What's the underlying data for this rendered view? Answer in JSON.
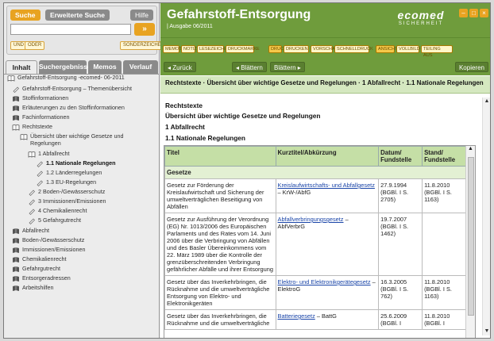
{
  "search": {
    "tab_active": "Suche",
    "tab_extended": "Erweiterte Suche",
    "help": "Hilfe",
    "go": "»",
    "btn_und": "UND",
    "btn_oder": "ODER",
    "btn_sonderzeichen": "SONDERZEICHEN"
  },
  "nav_tabs": [
    "Inhalt",
    "Suchergebnisse",
    "Memos",
    "Verlauf"
  ],
  "tree": [
    {
      "label": "Gefahrstoff-Entsorgung -ecomed- 06-2011",
      "icon": "book-open-icon"
    },
    {
      "label": "Gefahrstoff-Entsorgung – Themenübersicht",
      "icon": "page-icon"
    },
    {
      "label": "Stoffinformationen",
      "icon": "book-icon"
    },
    {
      "label": "Erläuterungen zu den Stoffinformationen",
      "icon": "book-icon"
    },
    {
      "label": "Fachinformationen",
      "icon": "book-icon"
    },
    {
      "label": "Rechtstexte",
      "icon": "book-open-icon"
    },
    {
      "label": "Übersicht über wichtige Gesetze und Regelungen",
      "icon": "book-open-icon"
    },
    {
      "label": "1 Abfallrecht",
      "icon": "book-open-icon"
    },
    {
      "label": "1.1 Nationale Regelungen",
      "icon": "page-icon",
      "bold": true
    },
    {
      "label": "1.2 Länderregelungen",
      "icon": "page-icon"
    },
    {
      "label": "1.3 EU-Regelungen",
      "icon": "page-icon"
    },
    {
      "label": "2 Boden-/Gewässerschutz",
      "icon": "page-icon"
    },
    {
      "label": "3 Immissionen/Emissionen",
      "icon": "page-icon"
    },
    {
      "label": "4 Chemikalienrecht",
      "icon": "page-icon"
    },
    {
      "label": "5 Gefahrgutrecht",
      "icon": "page-icon"
    },
    {
      "label": "Abfallrecht",
      "icon": "book-icon"
    },
    {
      "label": "Boden-/Gewässerschutz",
      "icon": "book-icon"
    },
    {
      "label": "Immissionen/Emissionen",
      "icon": "book-icon"
    },
    {
      "label": "Chemikalienrecht",
      "icon": "book-icon"
    },
    {
      "label": "Gefahrgutrecht",
      "icon": "book-icon"
    },
    {
      "label": "Entsorgeradressen",
      "icon": "book-icon"
    },
    {
      "label": "Arbeitshilfen",
      "icon": "book-icon"
    }
  ],
  "header": {
    "title": "Gefahrstoff-Entsorgung",
    "subtitle": "| Ausgabe 06/2011",
    "logo_main": "ecomed",
    "logo_sub": "SICHERHEIT"
  },
  "toolbar": {
    "group1": [
      "MEMOS",
      "NOTIZ",
      "LESEZEICHEN",
      "DRUCKMARKE"
    ],
    "group2": [
      "DRUCK",
      "DRUCKEN",
      "VORSCHAU",
      "SCHNELLDRUCK"
    ],
    "group3": [
      "ANSICHT",
      "VOLLBILD",
      "TEILING AUS"
    ]
  },
  "navbar": {
    "back": "◂ Zurück",
    "prev": "◂ Blättern",
    "next": "Blättern ▸",
    "copy": "Kopieren"
  },
  "breadcrumb": "Rechtstexte · Übersicht über wichtige Gesetze und Regelungen · 1 Abfallrecht · 1.1 Nationale Regelungen",
  "content": {
    "h1": "Rechtstexte",
    "h2": "Übersicht über wichtige Gesetze und Regelungen",
    "h3": "1 Abfallrecht",
    "h4": "1.1 Nationale Regelungen"
  },
  "table": {
    "headers": [
      "Titel",
      "Kurztitel/Abkürzung",
      "Datum/ Fundstelle",
      "Stand/ Fundstelle"
    ],
    "group": "Gesetze",
    "rows": [
      {
        "titel": "Gesetz zur Förderung der Kreislaufwirtschaft und Sicherung der umweltverträglichen Beseitigung von Abfällen",
        "link": "Kreislaufwirtschafts- und Abfallgesetz",
        "abk": " – KrW-/AbfG",
        "datum": "27.9.1994 (BGBl. I S. 2705)",
        "stand": "11.8.2010 (BGBl. I S. 1163)"
      },
      {
        "titel": "Gesetz zur Ausführung der Verordnung (EG) Nr. 1013/2006 des Europäischen Parlaments und des Rates vom 14. Juni 2006 über die Verbringung von Abfällen und des Basler Übereinkommens vom 22. März 1989 über die Kontrolle der grenzüberschreitenden Verbringung gefährlicher Abfälle und ihrer Entsorgung",
        "link": "Abfallverbringungsgesetz",
        "abk": " – AbfVerbrG",
        "datum": "19.7.2007 (BGBl. I S. 1462)",
        "stand": ""
      },
      {
        "titel": "Gesetz über das Inverkehrbringen, die Rücknahme und die umweltverträgliche Entsorgung von Elektro- und Elektronikgeräten",
        "link": "Elektro- und Elektronikgerätegesetz",
        "abk": " – ElektroG",
        "datum": "16.3.2005 (BGBl. I S. 762)",
        "stand": "11.8.2010 (BGBl. I S. 1163)"
      },
      {
        "titel": "Gesetz über das Inverkehrbringen, die Rücknahme und die umweltverträgliche",
        "link": "Batteriegesetz",
        "abk": " – BattG",
        "datum": "25.6.2009 (BGBl. I",
        "stand": "11.8.2010 (BGBl. I"
      }
    ]
  },
  "colors": {
    "green": "#6f9c3c",
    "light_green": "#d5e8c0",
    "orange": "#e8a321",
    "link": "#1a45a8"
  }
}
